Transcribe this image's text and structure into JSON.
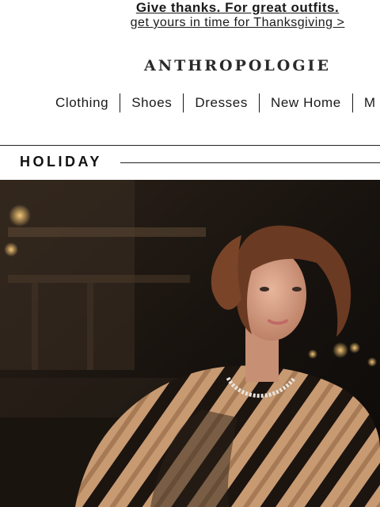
{
  "promo": {
    "headline": "Give thanks. For great outfits.",
    "link": "get yours in time for Thanksgiving >"
  },
  "brand": {
    "logo_text": "ANTHROPOLOGIE"
  },
  "nav": {
    "items": [
      "Clothing",
      "Shoes",
      "Dresses",
      "New Home",
      "M"
    ]
  },
  "section": {
    "title": "HOLIDAY"
  },
  "hero": {
    "image": "holiday-model-fur-coat-photo"
  },
  "colors": {
    "text": "#1a1a1a",
    "background": "#ffffff",
    "rule": "#222222"
  }
}
